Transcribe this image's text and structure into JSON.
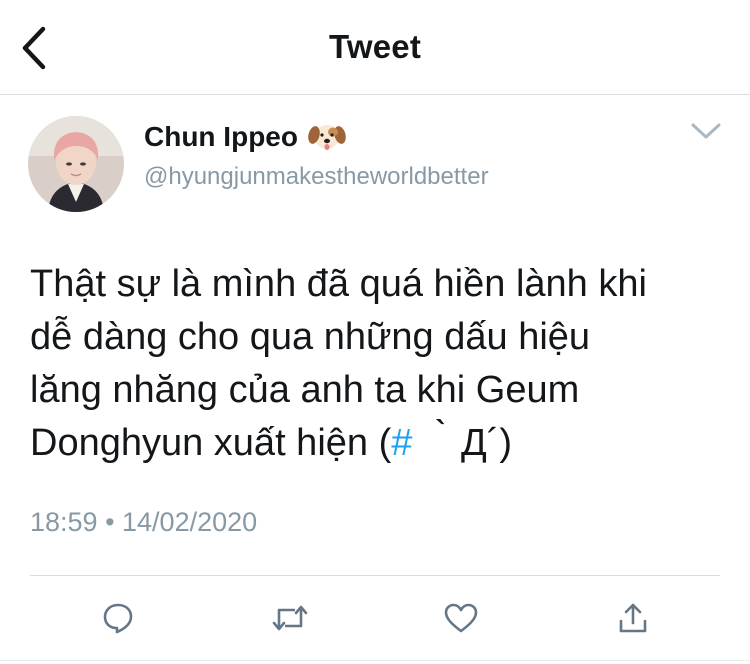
{
  "header": {
    "title": "Tweet",
    "back_icon": "chevron-left-icon"
  },
  "author": {
    "display_name": "Chun Ippeo",
    "name_emoji": "dog-face-icon",
    "username": "@hyungjunmakestheworldbetter"
  },
  "tweet": {
    "text_lines": [
      "Thật sự là mình đã quá hiền lành khi",
      "dễ dàng cho qua những dấu hiệu",
      "lăng nhăng của anh ta khi Geum"
    ],
    "last_line_before_hashtag": "Donghyun xuất hiện (",
    "hashtag": "#",
    "last_line_after_hashtag": " ｀Д´)",
    "timestamp": "18:59 • 14/02/2020"
  },
  "actions": {
    "reply_icon": "reply-icon",
    "retweet_icon": "retweet-icon",
    "like_icon": "heart-icon",
    "share_icon": "share-icon"
  },
  "colors": {
    "text": "#14171a",
    "secondary": "#8899a6",
    "accent": "#1da1f2",
    "divider": "#d8dde2"
  }
}
